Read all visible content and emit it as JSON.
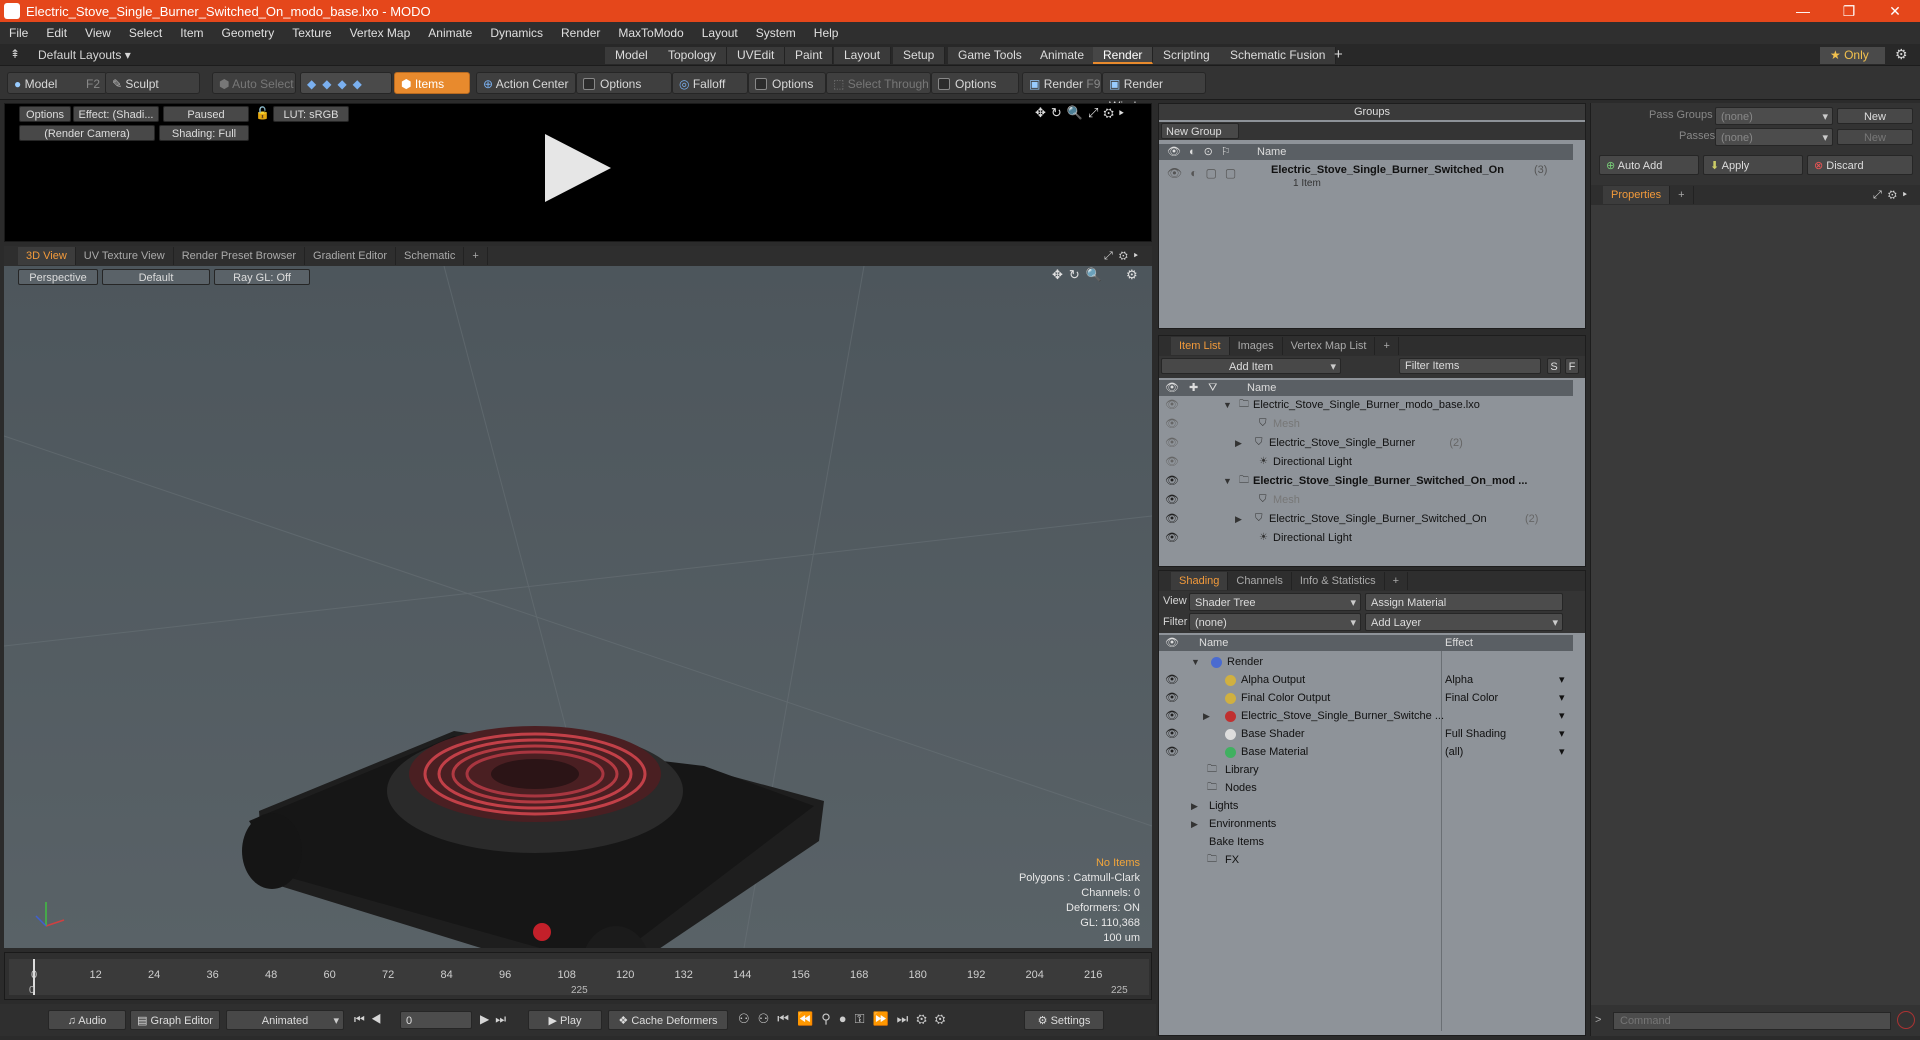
{
  "window": {
    "title": "Electric_Stove_Single_Burner_Switched_On_modo_base.lxo - MODO",
    "minimize": "—",
    "maximize": "❐",
    "close": "✕"
  },
  "menu": [
    "File",
    "Edit",
    "View",
    "Select",
    "Item",
    "Geometry",
    "Texture",
    "Vertex Map",
    "Animate",
    "Dynamics",
    "Render",
    "MaxToModo",
    "Layout",
    "System",
    "Help"
  ],
  "modebar": {
    "layouts": "Default Layouts ▾",
    "tabs": [
      "Model",
      "Topology",
      "UVEdit",
      "Paint",
      "Layout",
      "Setup",
      "Game Tools",
      "Animate",
      "Render",
      "Scripting",
      "Schematic Fusion"
    ],
    "active": "Render",
    "plus": "+",
    "only": "★  Only"
  },
  "toolbar": {
    "model": "Model",
    "model_key": "F2",
    "sculpt": "Sculpt",
    "auto_select": "Auto Select",
    "items": "Items",
    "action_center": "Action Center",
    "options1": "Options",
    "falloff": "Falloff",
    "options2": "Options",
    "select_through": "Select Through",
    "options3": "Options",
    "render": "Render",
    "render_key": "F9",
    "render_window": "Render Window"
  },
  "render_view": {
    "options": "Options",
    "effect": "Effect: (Shadi...",
    "paused": "Paused",
    "lut": "LUT: sRGB",
    "camera": "(Render Camera)",
    "shading": "Shading: Full"
  },
  "viewport_tabs": [
    "3D View",
    "UV Texture View",
    "Render Preset Browser",
    "Gradient Editor",
    "Schematic",
    "+"
  ],
  "viewport": {
    "perspective": "Perspective",
    "default": "Default",
    "raygl": "Ray GL: Off",
    "stats": {
      "no_items": "No Items",
      "polygons": "Polygons : Catmull-Clark",
      "channels": "Channels: 0",
      "deformers": "Deformers: ON",
      "gl": "GL: 110,368",
      "units": "100 um"
    }
  },
  "timeline": {
    "ticks": [
      "0",
      "12",
      "24",
      "36",
      "48",
      "60",
      "72",
      "84",
      "96",
      "108",
      "120",
      "132",
      "144",
      "156",
      "168",
      "180",
      "192",
      "204",
      "216"
    ],
    "start": "0",
    "mid": "225",
    "end": "225"
  },
  "bottom": {
    "audio": "Audio",
    "graph_editor": "Graph Editor",
    "animated": "Animated",
    "frame": "0",
    "play": "Play",
    "cache": "Cache Deformers",
    "settings": "Settings"
  },
  "groups": {
    "title": "Groups",
    "new_group": "New Group",
    "col_name": "Name",
    "item_name": "Electric_Stove_Single_Burner_Switched_On",
    "item_count": "(3)",
    "item_sub": "1 Item"
  },
  "item_list": {
    "tabs": [
      "Item List",
      "Images",
      "Vertex Map List",
      "+"
    ],
    "add_item": "Add Item",
    "filter": "Filter Items",
    "s": "S",
    "f": "F",
    "col_name": "Name",
    "rows": [
      {
        "text": "Electric_Stove_Single_Burner_modo_base.lxo",
        "bold": false,
        "grey": false
      },
      {
        "text": "Mesh",
        "bold": false,
        "grey": true
      },
      {
        "text": "Electric_Stove_Single_Burner",
        "extra": "(2)",
        "bold": false,
        "grey": false
      },
      {
        "text": "Directional Light",
        "bold": false,
        "grey": false
      },
      {
        "text": "Electric_Stove_Single_Burner_Switched_On_mod ...",
        "bold": true,
        "grey": false
      },
      {
        "text": "Mesh",
        "bold": false,
        "grey": true
      },
      {
        "text": "Electric_Stove_Single_Burner_Switched_On",
        "extra": "(2)",
        "bold": false,
        "grey": false
      },
      {
        "text": "Directional Light",
        "bold": false,
        "grey": false
      }
    ]
  },
  "shading": {
    "tabs": [
      "Shading",
      "Channels",
      "Info & Statistics",
      "+"
    ],
    "view_label": "View",
    "view_value": "Shader Tree",
    "assign": "Assign Material",
    "filter_label": "Filter",
    "filter_value": "(none)",
    "add_layer": "Add Layer",
    "col_name": "Name",
    "col_effect": "Effect",
    "rows": [
      {
        "name": "Render",
        "effect": ""
      },
      {
        "name": "Alpha Output",
        "effect": "Alpha"
      },
      {
        "name": "Final Color Output",
        "effect": "Final Color"
      },
      {
        "name": "Electric_Stove_Single_Burner_Switche ...",
        "effect": ""
      },
      {
        "name": "Base Shader",
        "effect": "Full Shading"
      },
      {
        "name": "Base Material",
        "effect": "(all)"
      },
      {
        "name": "Library",
        "effect": ""
      },
      {
        "name": "Nodes",
        "effect": ""
      },
      {
        "name": "Lights",
        "effect": ""
      },
      {
        "name": "Environments",
        "effect": ""
      },
      {
        "name": "Bake Items",
        "effect": ""
      },
      {
        "name": "FX",
        "effect": ""
      }
    ]
  },
  "passes": {
    "pass_groups_label": "Pass Groups",
    "pass_groups_value": "(none)",
    "new": "New",
    "passes_label": "Passes",
    "passes_value": "(none)",
    "new2": "New",
    "auto_add": "Auto Add",
    "apply": "Apply",
    "discard": "Discard",
    "properties": "Properties",
    "plus": "+"
  },
  "command": {
    "placeholder": "Command"
  },
  "colors": {
    "accent": "#e88a2d",
    "titlebar": "#e5471b"
  }
}
